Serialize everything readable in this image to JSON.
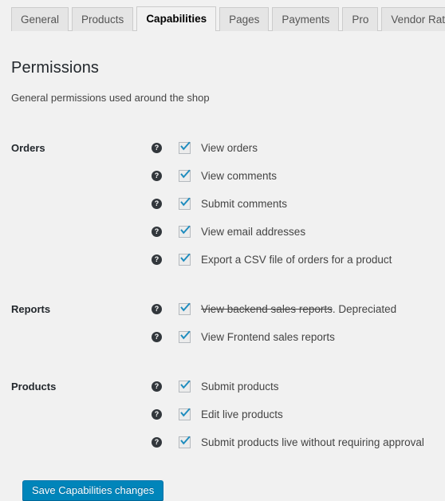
{
  "tabs": [
    {
      "label": "General",
      "active": false
    },
    {
      "label": "Products",
      "active": false
    },
    {
      "label": "Capabilities",
      "active": true
    },
    {
      "label": "Pages",
      "active": false
    },
    {
      "label": "Payments",
      "active": false
    },
    {
      "label": "Pro",
      "active": false
    },
    {
      "label": "Vendor Ratings",
      "active": false
    }
  ],
  "page": {
    "title": "Permissions",
    "description": "General permissions used around the shop"
  },
  "groups": [
    {
      "label": "Orders",
      "rows": [
        {
          "help": "help-icon",
          "checked": true,
          "label": "View orders",
          "strike": false
        },
        {
          "help": "help-icon",
          "checked": true,
          "label": "View comments",
          "strike": false
        },
        {
          "help": "help-icon",
          "checked": true,
          "label": "Submit comments",
          "strike": false
        },
        {
          "help": "help-icon",
          "checked": true,
          "label": "View email addresses",
          "strike": false
        },
        {
          "help": "help-icon",
          "checked": true,
          "label": "Export a CSV file of orders for a product",
          "strike": false
        }
      ]
    },
    {
      "label": "Reports",
      "rows": [
        {
          "help": "help-icon",
          "checked": true,
          "label": "View backend sales reports",
          "suffix": ". Depreciated",
          "strike": true
        },
        {
          "help": "help-icon",
          "checked": true,
          "label": "View Frontend sales reports",
          "strike": false
        }
      ]
    },
    {
      "label": "Products",
      "rows": [
        {
          "help": "help-icon",
          "checked": true,
          "label": "Submit products",
          "strike": false
        },
        {
          "help": "help-icon",
          "checked": true,
          "label": "Edit live products",
          "strike": false
        },
        {
          "help": "help-icon",
          "checked": true,
          "label": "Submit products live without requiring approval",
          "strike": false
        }
      ]
    }
  ],
  "actions": {
    "save_label": "Save Capabilities changes"
  },
  "colors": {
    "background": "#f1f1f1",
    "tab_inactive": "#e5e5e5",
    "tab_border": "#cccccc",
    "heading": "#23282d",
    "text": "#444444",
    "checkbox_check": "#1e8cbe",
    "help_icon_bg": "#32373c",
    "button_bg": "#0085ba",
    "button_border": "#0073aa"
  },
  "icons": {
    "help": "?",
    "check": "check-mark"
  }
}
